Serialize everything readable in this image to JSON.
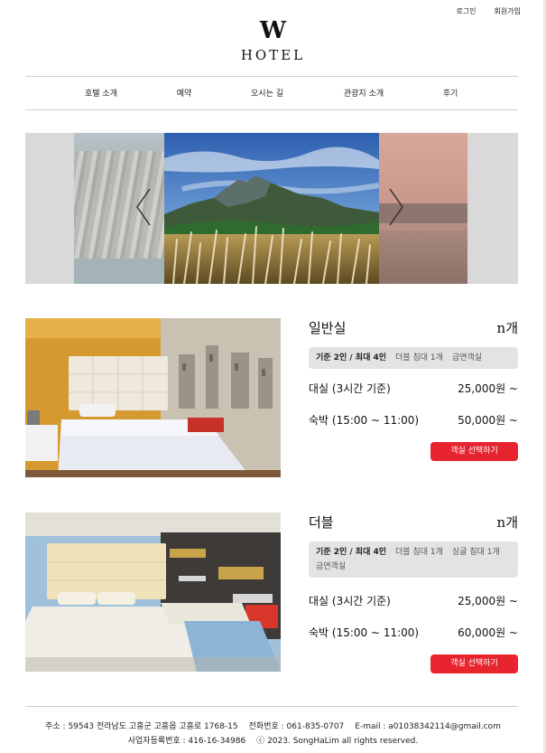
{
  "header": {
    "login_label": "로그인",
    "signup_label": "회원가입",
    "logo_mark": "W",
    "logo_text": "HOTEL"
  },
  "nav": {
    "items": [
      "호텔 소개",
      "예약",
      "오시는 길",
      "관광지 소개",
      "후기"
    ]
  },
  "carousel": {
    "prev_icon": "chevron-left-icon",
    "next_icon": "chevron-right-icon"
  },
  "rooms": [
    {
      "name": "일반실",
      "count": "n개",
      "tags_strong": "기준 2인 / 최대 4인",
      "tags": [
        "더블 침대 1개",
        "금연객실"
      ],
      "rental_label": "대실 (3시간 기준)",
      "rental_price": "25,000원 ~",
      "stay_label": "숙박 (15:00 ~ 11:00)",
      "stay_price": "50,000원 ~",
      "button_label": "객실 선택하기"
    },
    {
      "name": "더블",
      "count": "n개",
      "tags_strong": "기준 2인 / 최대 4인",
      "tags": [
        "더블 침대 1개",
        "싱글 침대 1개",
        "금연객실"
      ],
      "rental_label": "대실 (3시간 기준)",
      "rental_price": "25,000원 ~",
      "stay_label": "숙박 (15:00 ~ 11:00)",
      "stay_price": "60,000원 ~",
      "button_label": "객실 선택하기"
    }
  ],
  "footer": {
    "address": "주소 : 59543 전라남도 고흥군 고흥읍 고흥로 1768-15",
    "phone": "전화번호 : 061-835-0707",
    "email": "E-mail : a01038342114@gmail.com",
    "business_no": "사업자등록번호 : 416-16-34986",
    "copyright": "ⓒ 2023. SongHaLim all rights reserved."
  },
  "colors": {
    "accent": "#e8242f",
    "tag_background": "#e3e3e3",
    "divider": "#cfcfcf"
  }
}
